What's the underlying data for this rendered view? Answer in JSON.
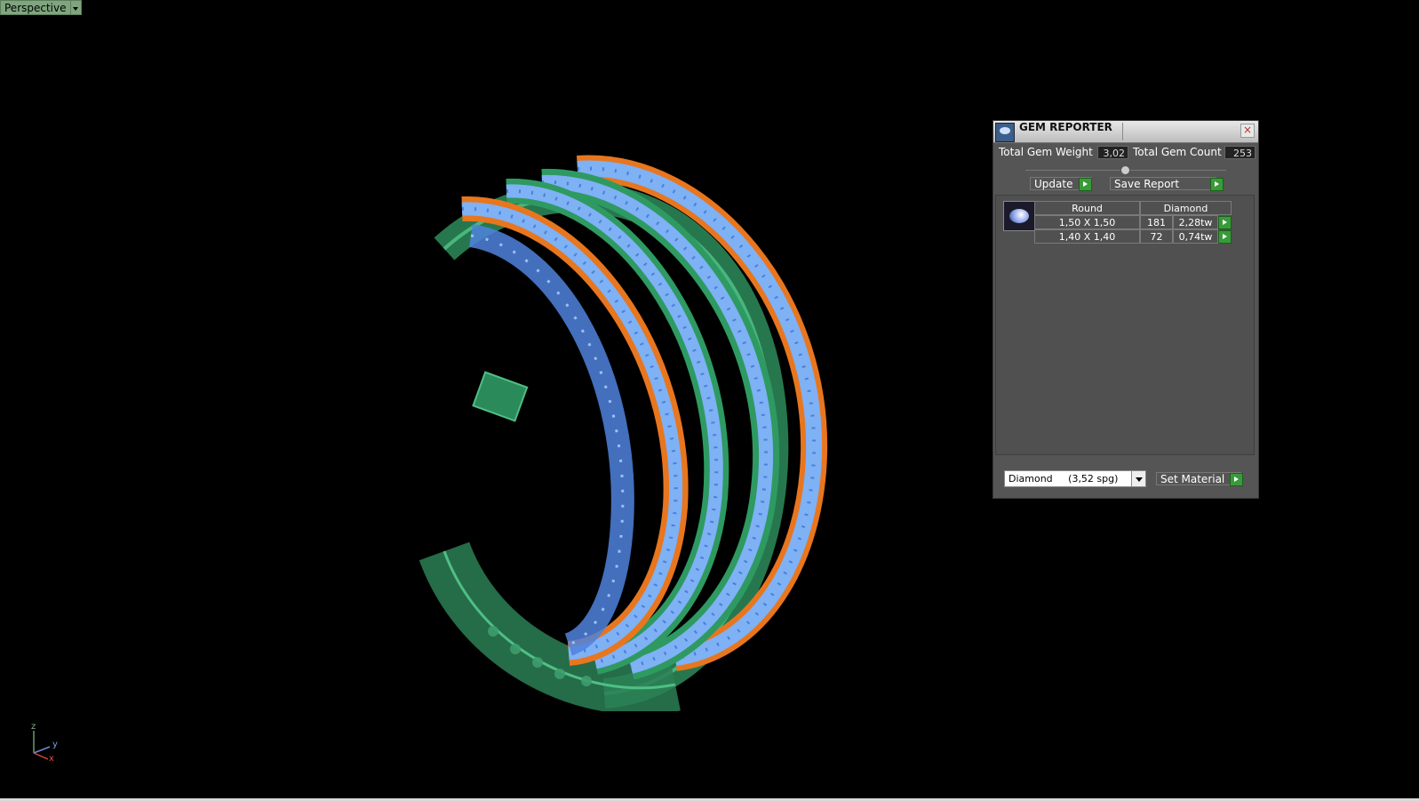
{
  "viewport": {
    "view_name": "Perspective",
    "axis_labels": {
      "z": "z",
      "y": "y",
      "x": "x"
    }
  },
  "gem_reporter": {
    "title": "GEM REPORTER",
    "total_weight_label": "Total Gem Weight",
    "total_weight_value": "3,02",
    "total_count_label": "Total Gem Count",
    "total_count_value": "253",
    "update_label": "Update",
    "save_report_label": "Save Report",
    "table": {
      "headers": [
        "Round",
        "Diamond"
      ],
      "rows": [
        {
          "size": "1,50 X 1,50",
          "count": "181",
          "weight": "2,28tw"
        },
        {
          "size": "1,40 X 1,40",
          "count": "72",
          "weight": "0,74tw"
        }
      ]
    },
    "material_selected": "Diamond     (3,52 spg)",
    "set_material_label": "Set Material"
  },
  "colors": {
    "green_metal": "#2f9a64",
    "orange_metal": "#e8761e",
    "blue_gems": "#6f9ee8",
    "panel_bg": "#555555"
  }
}
